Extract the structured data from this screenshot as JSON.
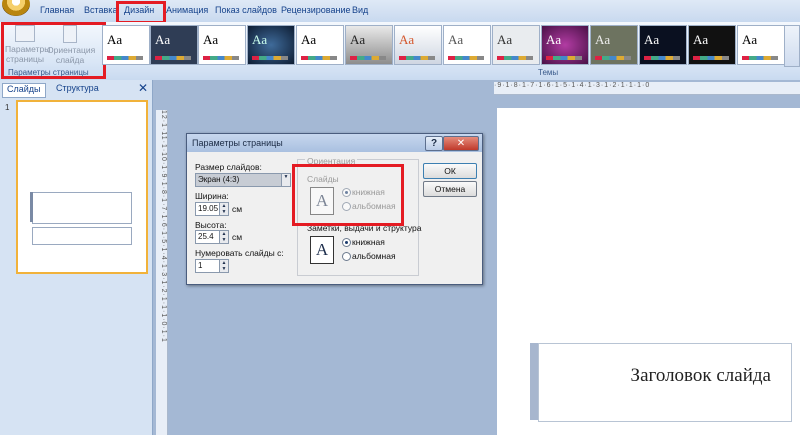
{
  "tabs": [
    "Главная",
    "Вставка",
    "Дизайн",
    "Анимация",
    "Показ слайдов",
    "Рецензирование",
    "Вид"
  ],
  "ribbon": {
    "page_setup_label": "Параметры страницы",
    "orientation_label": "Ориентация слайда",
    "page_setup_group": "Параметры страницы",
    "themes_group": "Темы",
    "theme_sample": "Aa"
  },
  "left_panel": {
    "tab_slides": "Слайды",
    "tab_structure": "Структура",
    "slide_number": "1"
  },
  "rulers": {
    "horizontal": "·9·1·8·1·7·1·6·1·5·1·4·1·3·1·2·1·1·1·0",
    "vertical": "12·1·11·1·10·1·9·1·8·1·7·1·6·1·5·1·4·1·3·1·2·1·1·1·0·1·1"
  },
  "slide": {
    "title": "Заголовок слайда"
  },
  "dialog": {
    "title": "Параметры страницы",
    "help": "?",
    "close": "✕",
    "slide_size_label": "Размер слайдов:",
    "slide_size_value": "Экран (4:3)",
    "width_label": "Ширина:",
    "width_value": "19.05",
    "height_label": "Высота:",
    "height_value": "25.4",
    "unit": "см",
    "number_from_label": "Нумеровать слайды с:",
    "number_from_value": "1",
    "orientation_group": "Ориентация",
    "slides_label": "Слайды",
    "portrait": "книжная",
    "landscape": "альбомная",
    "notes_label": "Заметки, выдачи и структура",
    "ok": "ОК",
    "cancel": "Отмена",
    "icon_letter": "A"
  }
}
